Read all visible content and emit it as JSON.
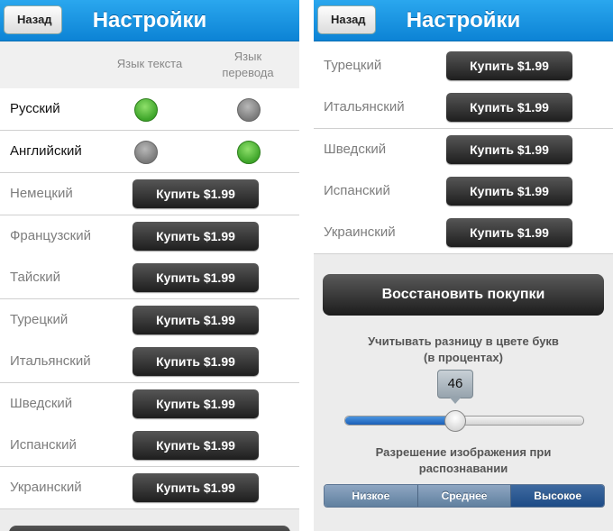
{
  "nav": {
    "back": "Назад",
    "title": "Настройки"
  },
  "columns": {
    "text_lang": "Язык текста",
    "translation_lang_l1": "Язык",
    "translation_lang_l2": "перевода"
  },
  "owned_languages": [
    {
      "name": "Русский",
      "text_selected": true,
      "translation_selected": false
    },
    {
      "name": "Английский",
      "text_selected": false,
      "translation_selected": true
    }
  ],
  "locked_languages": [
    "Немецкий",
    "Французский",
    "Тайский",
    "Турецкий",
    "Итальянский",
    "Шведский",
    "Испанский",
    "Украинский"
  ],
  "buy_label": "Купить $1.99",
  "right_locked_languages": [
    "Турецкий",
    "Итальянский",
    "Шведский",
    "Испанский",
    "Украинский"
  ],
  "restore_label": "Восстановить покупки",
  "color_diff": {
    "caption_l1": "Учитывать разницу в цвете букв",
    "caption_l2": "(в процентах)",
    "value": "46",
    "fraction": 0.46
  },
  "resolution": {
    "caption_l1": "Разрешение изображения при",
    "caption_l2": "распознавании",
    "options": [
      "Низкое",
      "Среднее",
      "Высокое"
    ],
    "selected": "Высокое"
  },
  "colors": {
    "nav": "#1a96e3",
    "on": "#4fbf35",
    "off": "#8a8a8a",
    "button": "#2a2a2a",
    "segment_selected": "#2a5a96"
  }
}
